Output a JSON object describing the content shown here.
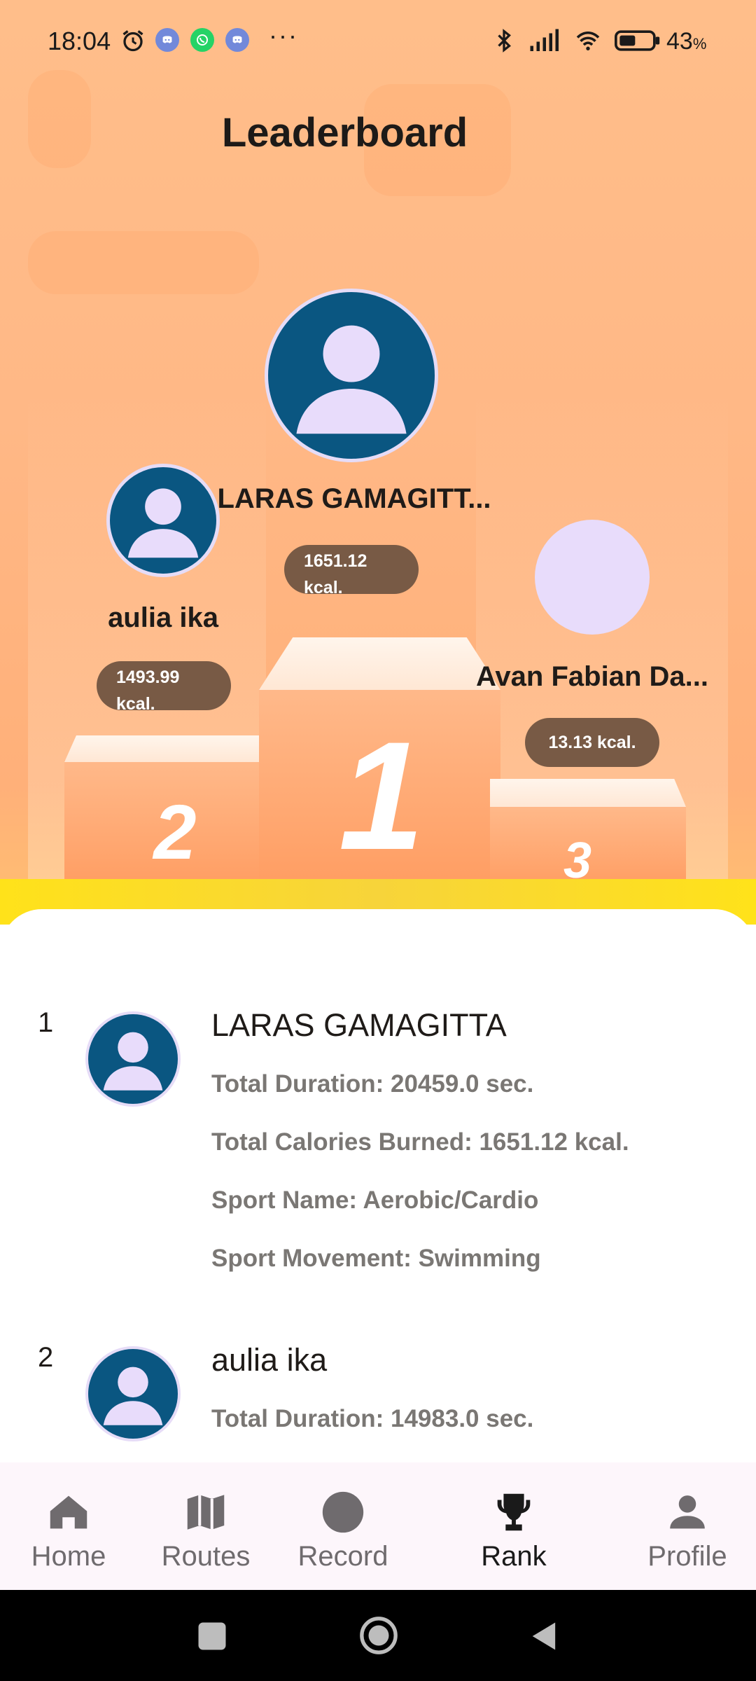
{
  "status_bar": {
    "time": "18:04",
    "more": "···",
    "battery": "43",
    "battery_unit": "%"
  },
  "page": {
    "title": "Leaderboard"
  },
  "podium": {
    "first": {
      "place": "1",
      "name": "LARAS GAMAGITT...",
      "calories": "1651.12 kcal."
    },
    "second": {
      "place": "2",
      "name": "aulia ika",
      "calories": "1493.99 kcal."
    },
    "third": {
      "place": "3",
      "name": "Avan Fabian Da...",
      "calories": "13.13 kcal."
    }
  },
  "entries": [
    {
      "rank": "1",
      "name": "LARAS GAMAGITTA",
      "duration": "Total Duration: 20459.0 sec.",
      "calories": "Total Calories Burned: 1651.12 kcal.",
      "sport_name": "Sport Name: Aerobic/Cardio",
      "sport_movement": "Sport Movement: Swimming"
    },
    {
      "rank": "2",
      "name": "aulia ika",
      "duration": "Total Duration: 14983.0 sec."
    }
  ],
  "nav": {
    "items": [
      {
        "label": "Home",
        "icon": "home-icon"
      },
      {
        "label": "Routes",
        "icon": "map-icon"
      },
      {
        "label": "Record",
        "icon": "record-icon"
      },
      {
        "label": "Rank",
        "icon": "trophy-icon",
        "active": true
      },
      {
        "label": "Profile",
        "icon": "person-icon"
      }
    ]
  },
  "colors": {
    "hero_bg": "#ffb886",
    "avatar_bg": "#0a5681",
    "avatar_fg": "#e8dcfb",
    "pill_bg": "#785a45",
    "gold_band": "#ffe21a",
    "stat_text": "#7a7774"
  }
}
